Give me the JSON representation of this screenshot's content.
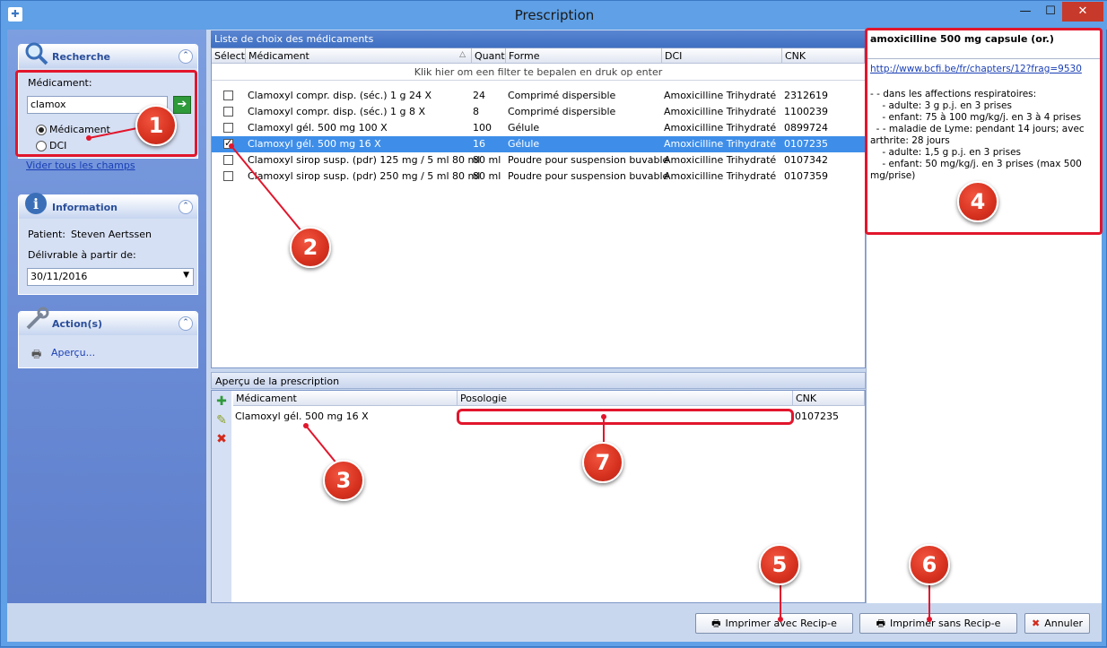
{
  "window": {
    "title": "Prescription",
    "minimize": "—",
    "maximize": "☐",
    "close": "✕"
  },
  "search_panel": {
    "title": "Recherche",
    "medicament_label": "Médicament:",
    "search_value": "clamox",
    "radio_medicament": "Médicament",
    "radio_dci": "DCI",
    "clear_link": "Vider tous les champs"
  },
  "info_panel": {
    "title": "Information",
    "patient_label": "Patient:",
    "patient_name": "Steven Aertssen",
    "deliverable_label": "Délivrable à partir de:",
    "date_value": "30/11/2016"
  },
  "actions_panel": {
    "title": "Action(s)",
    "preview_link": "Aperçu..."
  },
  "drug_list": {
    "title": "Liste de choix des médicaments",
    "columns": [
      "Sélecti",
      "Médicament",
      "Quantit",
      "Forme",
      "DCI",
      "CNK"
    ],
    "filter_hint": "Klik hier om een filter te bepalen en druk op enter",
    "rows": [
      {
        "checked": false,
        "name": "Clamoxyl compr. disp. (séc.) 1 g   24 X",
        "qty": "24",
        "form": "Comprimé dispersible",
        "dci": "Amoxicilline Trihydraté",
        "cnk": "2312619"
      },
      {
        "checked": false,
        "name": "Clamoxyl compr. disp. (séc.) 1 g   8 X",
        "qty": "8",
        "form": "Comprimé dispersible",
        "dci": "Amoxicilline Trihydraté",
        "cnk": "1100239"
      },
      {
        "checked": false,
        "name": "Clamoxyl gél. 500 mg   100 X",
        "qty": "100",
        "form": "Gélule",
        "dci": "Amoxicilline Trihydraté",
        "cnk": "0899724"
      },
      {
        "checked": true,
        "name": "Clamoxyl gél. 500 mg   16 X",
        "qty": "16",
        "form": "Gélule",
        "dci": "Amoxicilline Trihydraté",
        "cnk": "0107235"
      },
      {
        "checked": false,
        "name": "Clamoxyl sirop susp. (pdr) 125 mg / 5 ml   80 ml",
        "qty": "80 ml",
        "form": "Poudre pour suspension buvable",
        "dci": "Amoxicilline Trihydraté",
        "cnk": "0107342"
      },
      {
        "checked": false,
        "name": "Clamoxyl sirop susp. (pdr) 250 mg / 5 ml   80 ml",
        "qty": "80 ml",
        "form": "Poudre pour suspension buvable",
        "dci": "Amoxicilline Trihydraté",
        "cnk": "0107359"
      }
    ]
  },
  "preview": {
    "title": "Aperçu de la prescription",
    "columns": [
      "Médicament",
      "Posologie",
      "CNK"
    ],
    "rows": [
      {
        "name": "Clamoxyl gél. 500 mg   16 X",
        "posologie": "",
        "cnk": "0107235"
      }
    ]
  },
  "info_box": {
    "title": "amoxicilline 500 mg capsule (or.)",
    "link": "http://www.bcfi.be/fr/chapters/12?frag=9530",
    "lines": [
      "- - dans les affections respiratoires:",
      "    - adulte: 3 g p.j. en 3 prises",
      "    - enfant: 75 à 100 mg/kg/j. en 3 à 4 prises",
      "  - - maladie de Lyme: pendant 14 jours; avec",
      "arthrite: 28 jours",
      "    - adulte: 1,5 g p.j. en 3 prises",
      "    - enfant: 50 mg/kg/j. en 3 prises (max 500",
      "mg/prise)"
    ]
  },
  "buttons": {
    "print_recip": "Imprimer avec Recip-e",
    "print_no_recip": "Imprimer sans Recip-e",
    "cancel": "Annuler"
  },
  "annotations": [
    "1",
    "2",
    "3",
    "4",
    "5",
    "6",
    "7"
  ],
  "colors": {
    "highlight": "#3e8ee9",
    "annotation": "#e2162c"
  }
}
